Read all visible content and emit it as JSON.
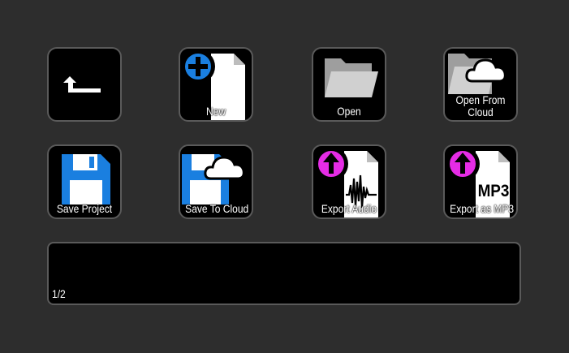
{
  "keys": [
    {
      "name": "back-key",
      "label": "",
      "icon": "back-arrow-icon"
    },
    {
      "name": "new-key",
      "label": "New",
      "icon": "new-document-icon"
    },
    {
      "name": "open-key",
      "label": "Open",
      "icon": "folder-icon"
    },
    {
      "name": "open-from-cloud-key",
      "label_line1": "Open From",
      "label_line2": "Cloud",
      "icon": "folder-cloud-icon"
    },
    {
      "name": "save-project-key",
      "label": "Save Project",
      "icon": "floppy-disk-icon"
    },
    {
      "name": "save-to-cloud-key",
      "label": "Save To Cloud",
      "icon": "floppy-cloud-icon"
    },
    {
      "name": "export-audio-key",
      "label": "Export Audio",
      "icon": "export-audio-icon"
    },
    {
      "name": "export-mp3-key",
      "label": "Export as MP3",
      "icon": "export-mp3-icon",
      "icon_text": "MP3"
    }
  ],
  "page_indicator": "1/2",
  "colors": {
    "background": "#2d2d2d",
    "key_bg": "#000000",
    "key_border": "#5a5a5a",
    "blue": "#1a7fe0",
    "magenta": "#e52ce5",
    "document": "#ffffff",
    "folder": "#bdbdbd"
  }
}
